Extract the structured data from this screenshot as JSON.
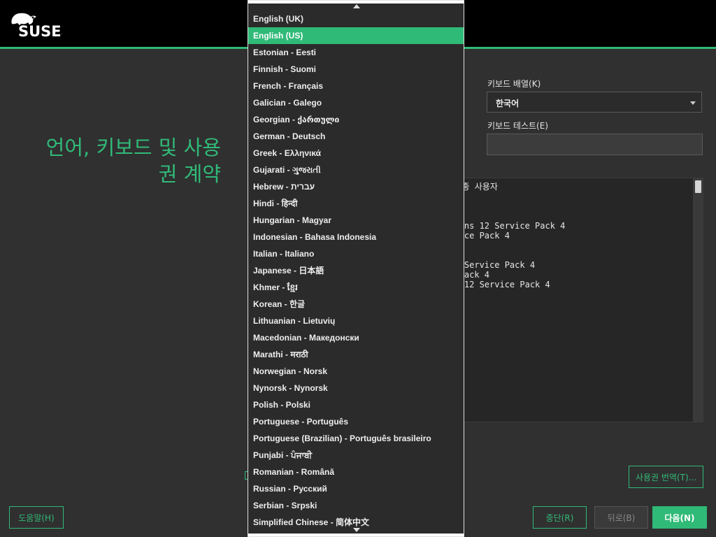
{
  "brand": {
    "name": "SUSE",
    "reg": "."
  },
  "page_title_line1": "언어, 키보드 및 사용",
  "page_title_line2": "권 계약",
  "keyboard": {
    "layout_label": "키보드 배열(K)",
    "layout_value": "한국어",
    "test_label": "키보드 테스트(E)",
    "test_value": ""
  },
  "license_text": "e 최종 사용자\n\n\nk 4\nations 12 Service Pack 4\nervice Pack 4\n\nck 4\n 12 Service Pack 4\nce Pack 4\nKit 12 Service Pack 4\n\n\n\n\n\n\n\n\n\n\n\n\n\nl\n견되는",
  "buttons": {
    "license_translations": "사용권 번역(T)...",
    "help": "도움말(H)",
    "abort": "중단(R)",
    "back": "뒤로(B)",
    "next": "다음(N)"
  },
  "language_list": {
    "selected_index": 1,
    "items": [
      "English (UK)",
      "English (US)",
      "Estonian - Eesti",
      "Finnish - Suomi",
      "French - Français",
      "Galician - Galego",
      "Georgian - ქართული",
      "German - Deutsch",
      "Greek - Ελληνικά",
      "Gujarati - ગુજરાતી",
      "Hebrew - עברית",
      "Hindi - हिन्दी",
      "Hungarian - Magyar",
      "Indonesian - Bahasa Indonesia",
      "Italian - Italiano",
      "Japanese - 日本語",
      "Khmer - ខ្មែរ",
      "Korean - 한글",
      "Lithuanian - Lietuvių",
      "Macedonian - Македонски",
      "Marathi - मराठी",
      "Norwegian - Norsk",
      "Nynorsk - Nynorsk",
      "Polish - Polski",
      "Portuguese - Português",
      "Portuguese (Brazilian) - Português brasileiro",
      "Punjabi - ਪੰਜਾਬੀ",
      "Romanian - Română",
      "Russian - Русский",
      "Serbian - Srpski",
      "Simplified Chinese - 简体中文"
    ]
  },
  "colors": {
    "accent": "#30ba78",
    "background": "#303030",
    "topbar": "#000000"
  }
}
